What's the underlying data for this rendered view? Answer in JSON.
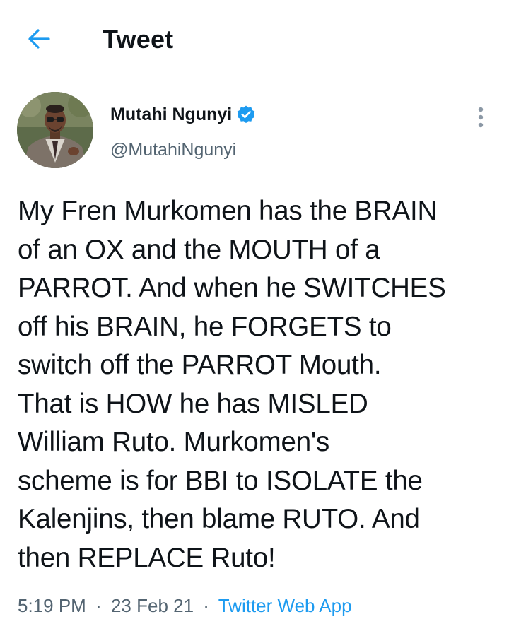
{
  "header": {
    "title": "Tweet",
    "back_icon": "arrow-left-icon"
  },
  "author": {
    "display_name": "Mutahi Ngunyi",
    "handle": "@MutahiNgunyi",
    "verified": true,
    "avatar_icon": "profile-photo"
  },
  "tweet": {
    "text": "My Fren Murkomen has the BRAIN\nof an OX and the MOUTH of a\nPARROT. And when he SWITCHES\noff his BRAIN, he FORGETS to\nswitch off the PARROT Mouth.\nThat is HOW he has MISLED\nWilliam Ruto. Murkomen's\nscheme is for BBI to ISOLATE the\nKalenjins, then blame RUTO. And\nthen REPLACE Ruto!",
    "time": "5:19 PM",
    "date": "23 Feb 21",
    "source": "Twitter Web App",
    "separator": "·"
  },
  "colors": {
    "accent": "#1d9bf0",
    "text": "#0f1419",
    "secondary": "#536471",
    "divider": "#e3e7eb"
  }
}
